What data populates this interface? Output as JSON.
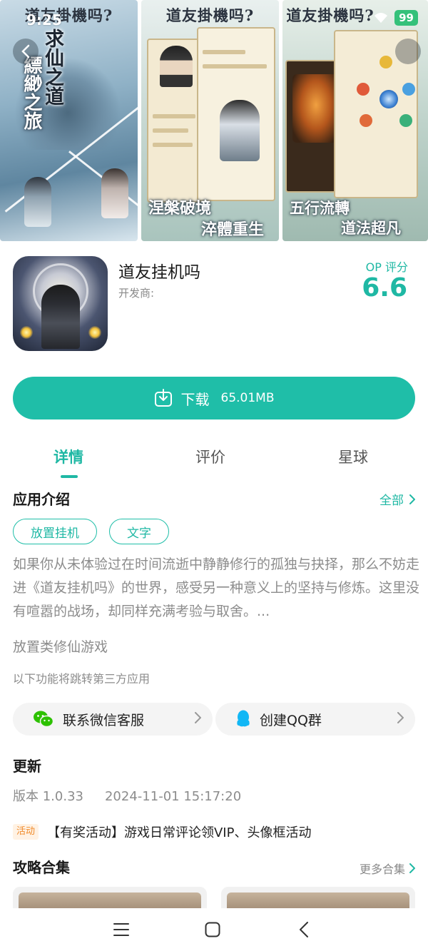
{
  "status_bar": {
    "time": "9:25",
    "battery": "99"
  },
  "gallery": {
    "shot1": {
      "title": "道友掛機吗?",
      "vertical_a": "求仙之道",
      "vertical_b": "縹緲之旅"
    },
    "shot2": {
      "title": "道友掛機吗?",
      "bottom_a": "涅槃破境",
      "bottom_b": "淬體重生"
    },
    "shot3": {
      "title": "道友掛機吗?",
      "bottom_a": "五行流轉",
      "bottom_b": "道法超凡"
    }
  },
  "app": {
    "name": "道友挂机吗",
    "developer_label": "开发商:",
    "rating_label": "OP 评分",
    "rating_value": "6.6",
    "accent_color": "#1fb8a4"
  },
  "download": {
    "label": "下载",
    "size": "65.01MB"
  },
  "tabs": [
    {
      "label": "详情",
      "active": true
    },
    {
      "label": "评价",
      "active": false
    },
    {
      "label": "星球",
      "active": false
    }
  ],
  "intro": {
    "title": "应用介绍",
    "more": "全部",
    "tags": [
      "放置挂机",
      "文字"
    ],
    "text": "如果你从未体验过在时间流逝中静静修行的孤独与抉择，那么不妨走进《道友挂机吗》的世界，感受另一种意义上的坚持与修炼。这里没有喧嚣的战场，却同样充满考验与取舍。...",
    "subtitle": "放置类修仙游戏",
    "third_party_note": "以下功能将跳转第三方应用"
  },
  "services": [
    {
      "label": "联系微信客服",
      "icon": "wechat-icon"
    },
    {
      "label": "创建QQ群",
      "icon": "qq-icon"
    }
  ],
  "update": {
    "title": "更新",
    "version": "版本 1.0.33",
    "date": "2024-11-01 15:17:20",
    "activity_badge": "活动",
    "activity_text": "【有奖活动】游戏日常评论领VIP、头像框活动"
  },
  "guides": {
    "title": "攻略合集",
    "more": "更多合集"
  },
  "navbar": {
    "buttons": [
      "menu-icon",
      "home-icon",
      "back-icon"
    ]
  }
}
